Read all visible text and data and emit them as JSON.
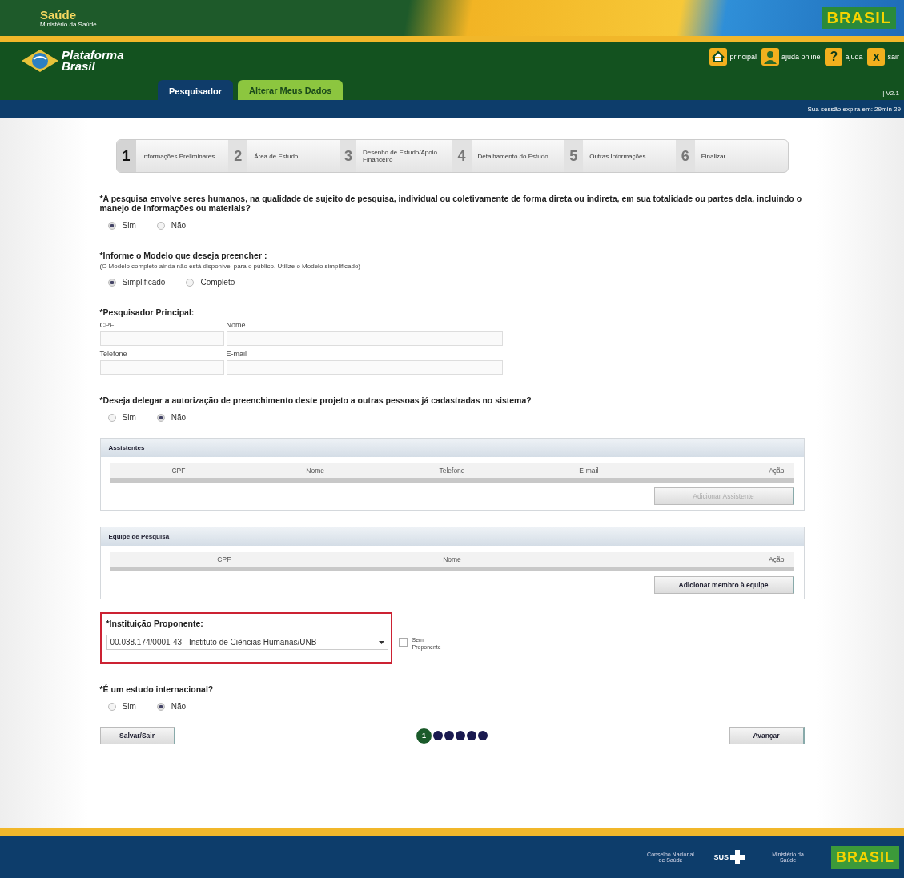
{
  "header": {
    "agency": "Saúde",
    "ministry": "Ministério da Saúde",
    "country_logo": "BRASIL"
  },
  "brand": {
    "line_1": "Plataforma",
    "line_2": "Brasil"
  },
  "tabs": [
    {
      "label": "Pesquisador",
      "selected": true
    },
    {
      "label": "Alterar Meus Dados",
      "selected": false
    }
  ],
  "top_links": [
    {
      "label": "principal",
      "kind": "home"
    },
    {
      "label": "ajuda online",
      "kind": "user"
    },
    {
      "label": "ajuda",
      "kind": "help",
      "glyph": "?"
    },
    {
      "label": "sair",
      "kind": "close",
      "glyph": "x"
    }
  ],
  "version": "| V2.1",
  "session": "Sua sessão expira em: 29min 29",
  "steps": [
    {
      "number": "1",
      "label": "Informações Preliminares",
      "selected": true
    },
    {
      "number": "2",
      "label": "Área de Estudo",
      "selected": false
    },
    {
      "number": "3",
      "label": "Desenho de Estudo/Apoio Financeiro",
      "selected": false
    },
    {
      "number": "4",
      "label": "Detalhamento do Estudo",
      "selected": false
    },
    {
      "number": "5",
      "label": "Outras Informações",
      "selected": false
    },
    {
      "number": "6",
      "label": "Finalizar",
      "selected": false
    }
  ],
  "sections": [
    {
      "kind": "radio",
      "label": "*A pesquisa envolve seres humanos, na qualidade de sujeito de pesquisa, individual ou coletivamente de forma direta ou indireta, em sua totalidade ou partes dela, incluindo o manejo de informações ou materiais?",
      "options": [
        {
          "label": "Sim",
          "selected": true
        },
        {
          "label": "Não",
          "selected": false
        }
      ]
    },
    {
      "kind": "radio",
      "label": "*Informe o Modelo que deseja preencher :",
      "note": "(O Modelo completo ainda não está disponível para o público. Utilize o Modelo simplificado)",
      "options": [
        {
          "label": "Simplificado",
          "selected": true
        },
        {
          "label": "Completo",
          "selected": false
        }
      ]
    },
    {
      "kind": "person",
      "label": "*Pesquisador Principal:",
      "fields": [
        {
          "label": "CPF"
        },
        {
          "label": "Nome"
        },
        {
          "label": "Telefone"
        },
        {
          "label": "E-mail"
        }
      ]
    },
    {
      "kind": "radio",
      "label": "*Deseja delegar a autorização de preenchimento deste projeto a outras pessoas já cadastradas no sistema?",
      "options": [
        {
          "label": "Sim",
          "selected": false
        },
        {
          "label": "Não",
          "selected": true
        }
      ]
    },
    {
      "kind": "table",
      "title": "Assistentes",
      "columns": [
        "CPF",
        "Nome",
        "Telefone",
        "E-mail",
        "Ação"
      ],
      "button": {
        "label": "Adicionar Assistente",
        "disabled": true
      }
    },
    {
      "kind": "table",
      "title": "Equipe de Pesquisa",
      "columns": [
        "CPF",
        "Nome",
        "Ação"
      ],
      "button": {
        "label": "Adicionar membro à equipe",
        "disabled": false
      }
    },
    {
      "kind": "select",
      "label": "*Instituição Proponente:",
      "value": "00.038.174/0001-43 - Instituto de Ciências Humanas/UNB",
      "highlighted": true,
      "checkbox": {
        "label": "Sem Proponente",
        "checked": false
      }
    },
    {
      "kind": "radio",
      "label": "*É um estudo internacional?",
      "options": [
        {
          "label": "Sim",
          "selected": false
        },
        {
          "label": "Não",
          "selected": true
        }
      ]
    }
  ],
  "buttons": {
    "back": "Salvar/Sair",
    "next": "Avançar"
  },
  "pager": [
    {
      "label": "1",
      "selected": true
    },
    {
      "selected": false
    },
    {
      "selected": false
    },
    {
      "selected": false
    },
    {
      "selected": false
    },
    {
      "selected": false
    }
  ],
  "footer": {
    "council": "Conselho Nacional de Saúde",
    "sus": "SUS",
    "ministry": "Ministério da Saúde",
    "country_logo": "BRASIL"
  }
}
